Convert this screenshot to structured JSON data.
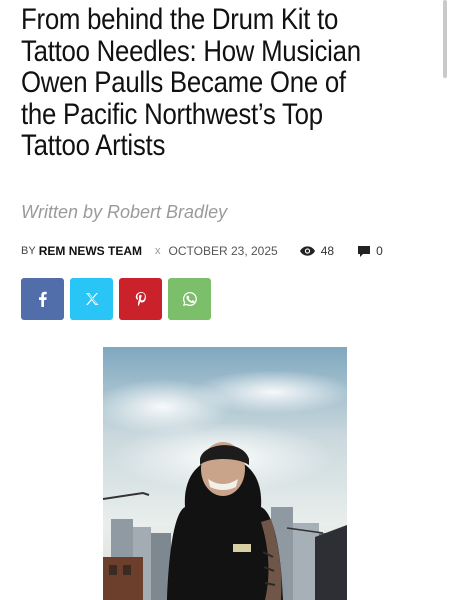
{
  "article": {
    "title": "From behind the Drum Kit to Tattoo Needles: How Musician Owen Paulls Became One of the Pacific Northwest’s Top Tattoo Artists",
    "written_by": "Written by Robert Bradley"
  },
  "meta": {
    "by_prefix": "BY",
    "author": "REM NEWS TEAM",
    "separator": "x",
    "date": "OCTOBER 23, 2025",
    "views": "48",
    "comments": "0"
  },
  "share": {
    "facebook_icon": "facebook-icon",
    "x_icon": "x-icon",
    "pinterest_icon": "pinterest-icon",
    "whatsapp_icon": "whatsapp-icon",
    "colors": {
      "facebook": "#516eab",
      "x": "#29c5f6",
      "pinterest": "#ca212a",
      "whatsapp": "#7bbf6a"
    }
  },
  "image": {
    "icon": "featured-photo"
  }
}
